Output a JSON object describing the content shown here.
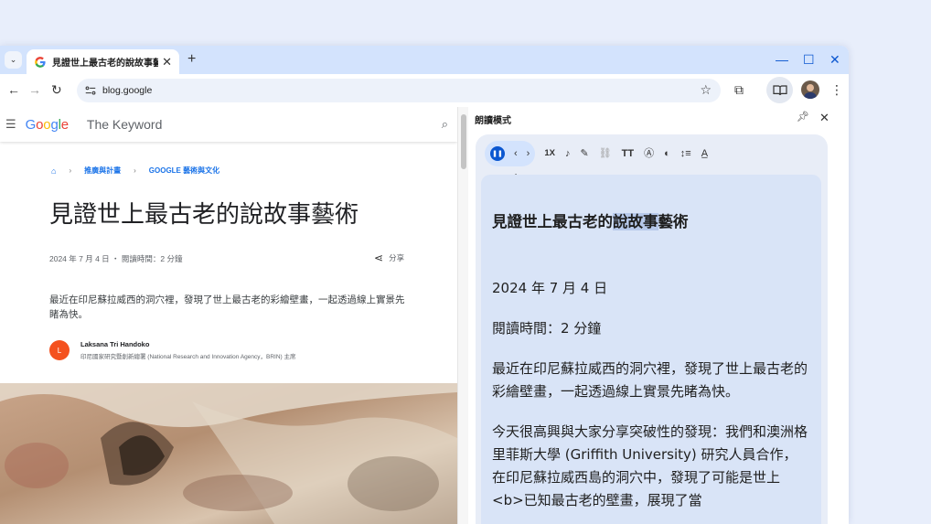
{
  "tab": {
    "title": "見證世上最古老的說故事藝術"
  },
  "toolbar": {
    "url": "blog.google"
  },
  "site": {
    "logo_letters": [
      "G",
      "o",
      "o",
      "g",
      "l",
      "e"
    ],
    "section": "The Keyword"
  },
  "breadcrumb": {
    "items": [
      "推廣與計畫",
      "GOOGLE 藝術與文化"
    ]
  },
  "article": {
    "title": "見證世上最古老的說故事藝術",
    "meta": "2024 年 7 月 4 日 ・ 閱讀時間：2 分鐘",
    "share_label": "分享",
    "lede": "最近在印尼蘇拉威西的洞穴裡，發現了世上最古老的彩繪壁畫，一起透過線上實景先睹為快。",
    "author_initial": "L",
    "author_name": "Laksana Tri Handoko",
    "author_org": "印尼國家研究暨創新總署 (National Research and Innovation Agency，BRIN) 主席"
  },
  "panel": {
    "title": "朗讀模式",
    "speed": "1X",
    "heading_before": "見證世上最古老的",
    "heading_highlight": "說故事",
    "heading_after": "藝術",
    "paragraphs": [
      "2024 年 7 月 4 日",
      "閱讀時間：2 分鐘",
      "最近在印尼蘇拉威西的洞穴裡，發現了世上最古老的彩繪壁畫，一起透過線上實景先睹為快。",
      "今天很高興與大家分享突破性的發現：我們和澳洲格里菲斯大學 (Griffith University) 研究人員合作，在印尼蘇拉威西島的洞穴中，發現了可能是世上<b>已知最古老的壁畫，展現了當"
    ]
  },
  "colors": {
    "accent": "#0b57d0",
    "tabstrip": "#d3e3fd",
    "panel_bg": "#d9e4f7",
    "highlight": "#b6c8ea"
  },
  "icons": [
    "tab-search-icon",
    "google-g-icon",
    "close-icon",
    "plus-icon",
    "minimize-icon",
    "maximize-icon",
    "back-icon",
    "forward-icon",
    "reload-icon",
    "site-info-icon",
    "star-icon",
    "extensions-icon",
    "reading-mode-icon",
    "menu-icon",
    "hamburger-icon",
    "search-icon",
    "home-icon",
    "share-icon",
    "pin-icon",
    "pause-icon",
    "chevron-left-icon",
    "chevron-right-icon",
    "voice-icon",
    "highlight-off-icon",
    "link-icon",
    "text-size-icon",
    "font-icon",
    "color-palette-icon",
    "line-spacing-icon",
    "letter-spacing-icon",
    "hand-cursor-icon"
  ]
}
